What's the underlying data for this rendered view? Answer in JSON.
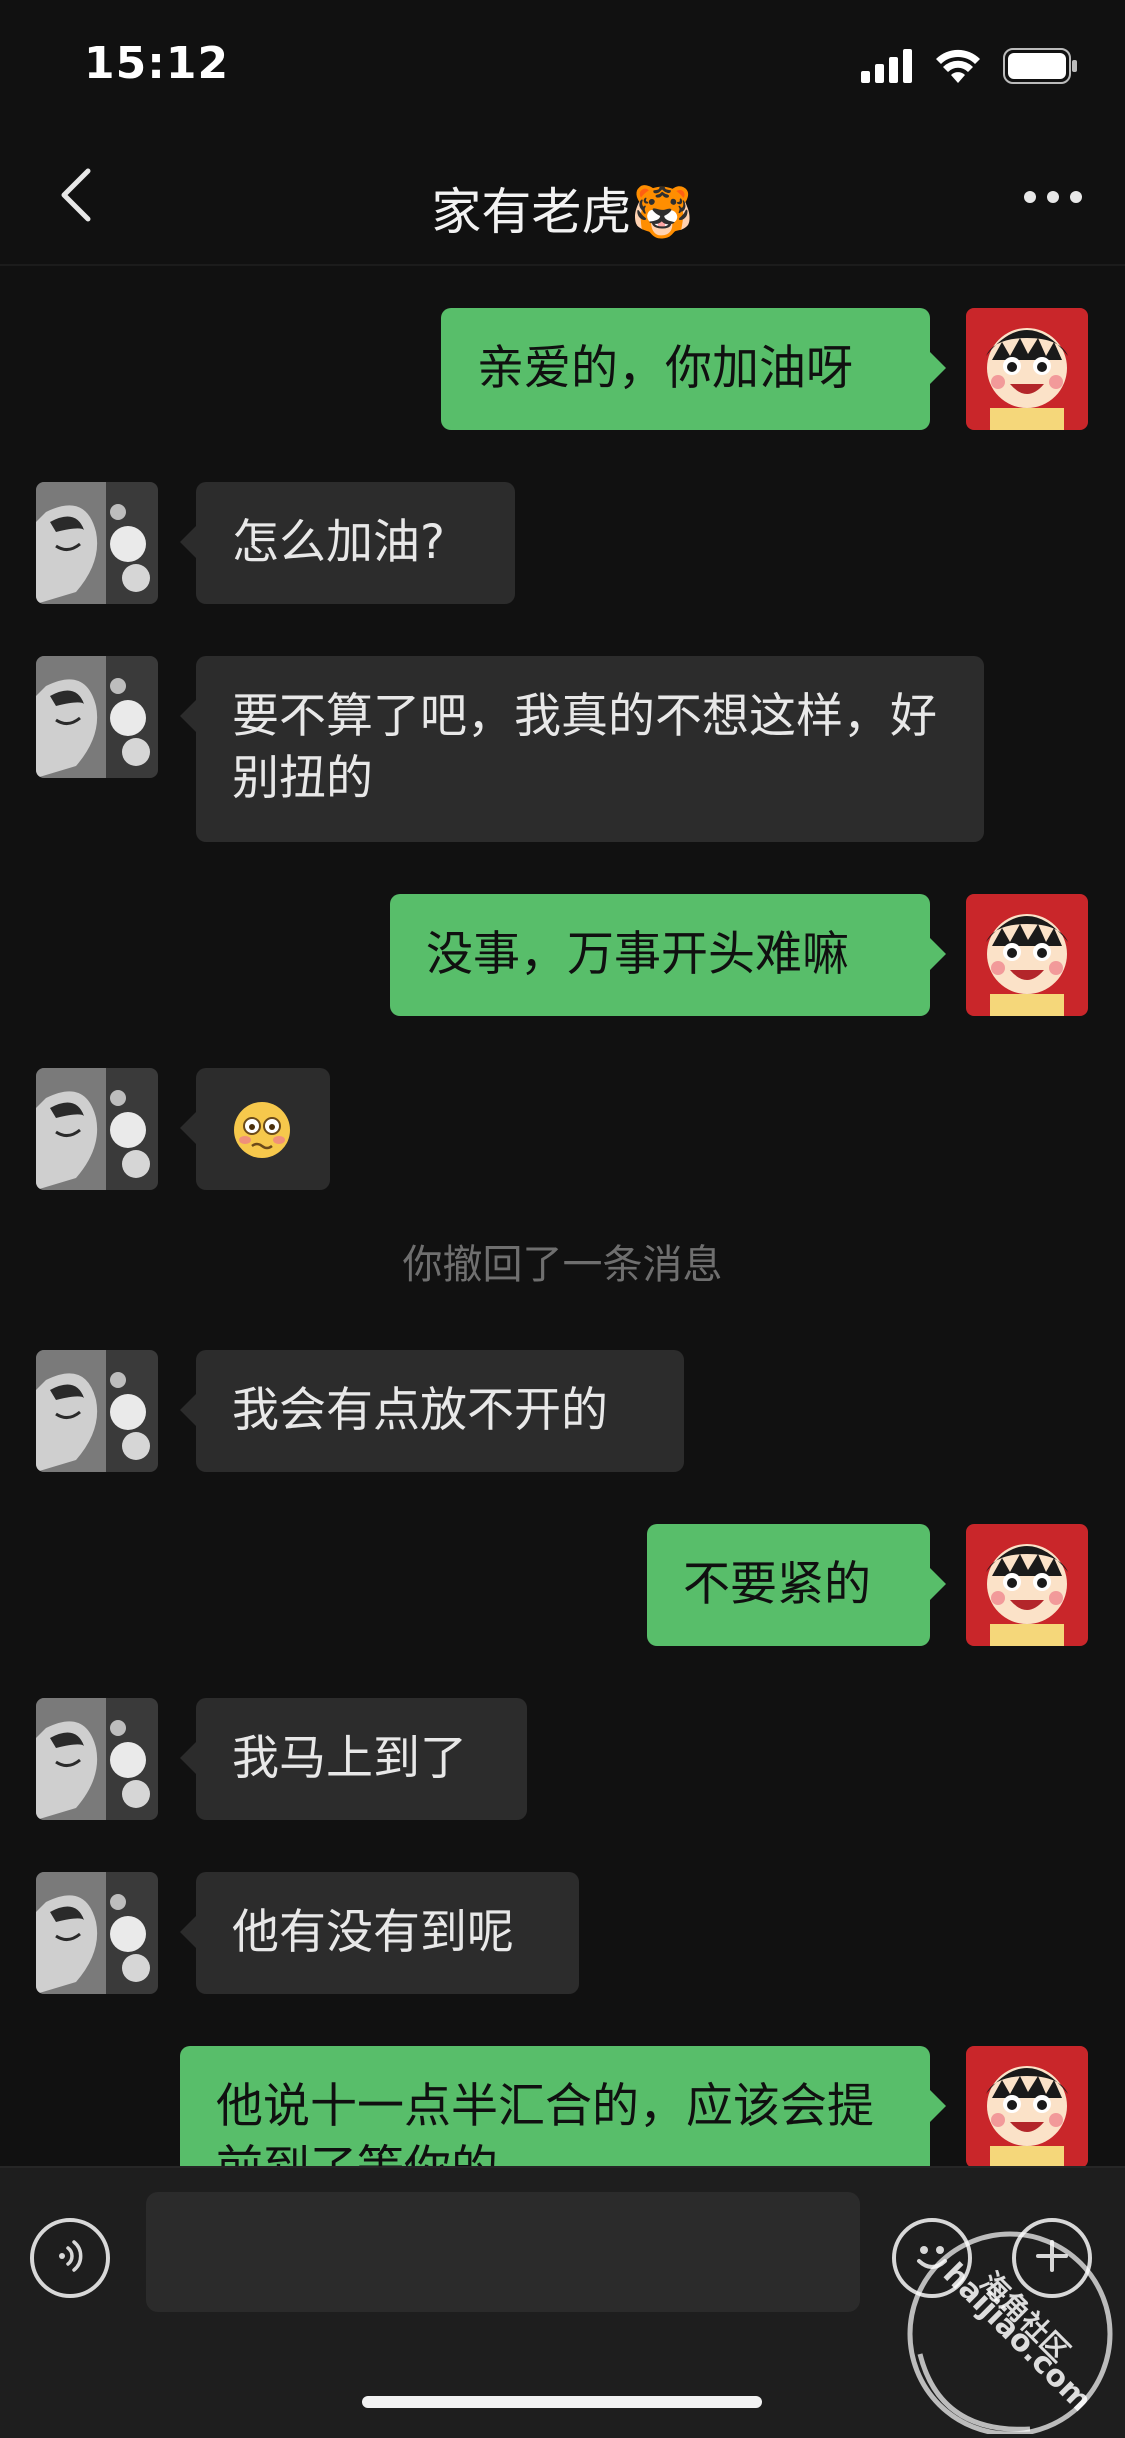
{
  "status_bar": {
    "time": "15:12",
    "icons": [
      "cellular-signal-icon",
      "wifi-icon",
      "battery-icon"
    ]
  },
  "header": {
    "title": "家有老虎🐯",
    "back_icon": "chevron-left-icon",
    "more_icon": "more-dots-icon"
  },
  "messages": [
    {
      "direction": "out",
      "text": "亲爱的，你加油呀"
    },
    {
      "direction": "in",
      "text": "怎么加油?"
    },
    {
      "direction": "in",
      "text": "要不算了吧，我真的不想这样，好别扭的"
    },
    {
      "direction": "out",
      "text": "没事，万事开头难嘛"
    },
    {
      "direction": "in",
      "text": "",
      "emoji": "flushed-face-emoji"
    },
    {
      "direction": "system",
      "text": "你撤回了一条消息"
    },
    {
      "direction": "in",
      "text": "我会有点放不开的"
    },
    {
      "direction": "out",
      "text": "不要紧的"
    },
    {
      "direction": "in",
      "text": "我马上到了"
    },
    {
      "direction": "in",
      "text": "他有没有到呢"
    },
    {
      "direction": "out",
      "text": "他说十一点半汇合的，应该会提前到了等你的"
    }
  ],
  "input_bar": {
    "voice_icon": "voice-icon",
    "input_value": "",
    "emoji_icon": "smiley-face-icon",
    "plus_icon": "plus-icon"
  },
  "watermark": {
    "line1": "海角社区",
    "line2": "haijiao.com"
  },
  "colors": {
    "background": "#111111",
    "incoming_bubble": "#2c2c2c",
    "outgoing_bubble": "#58be6a",
    "input_bar": "#1e1e1e"
  }
}
